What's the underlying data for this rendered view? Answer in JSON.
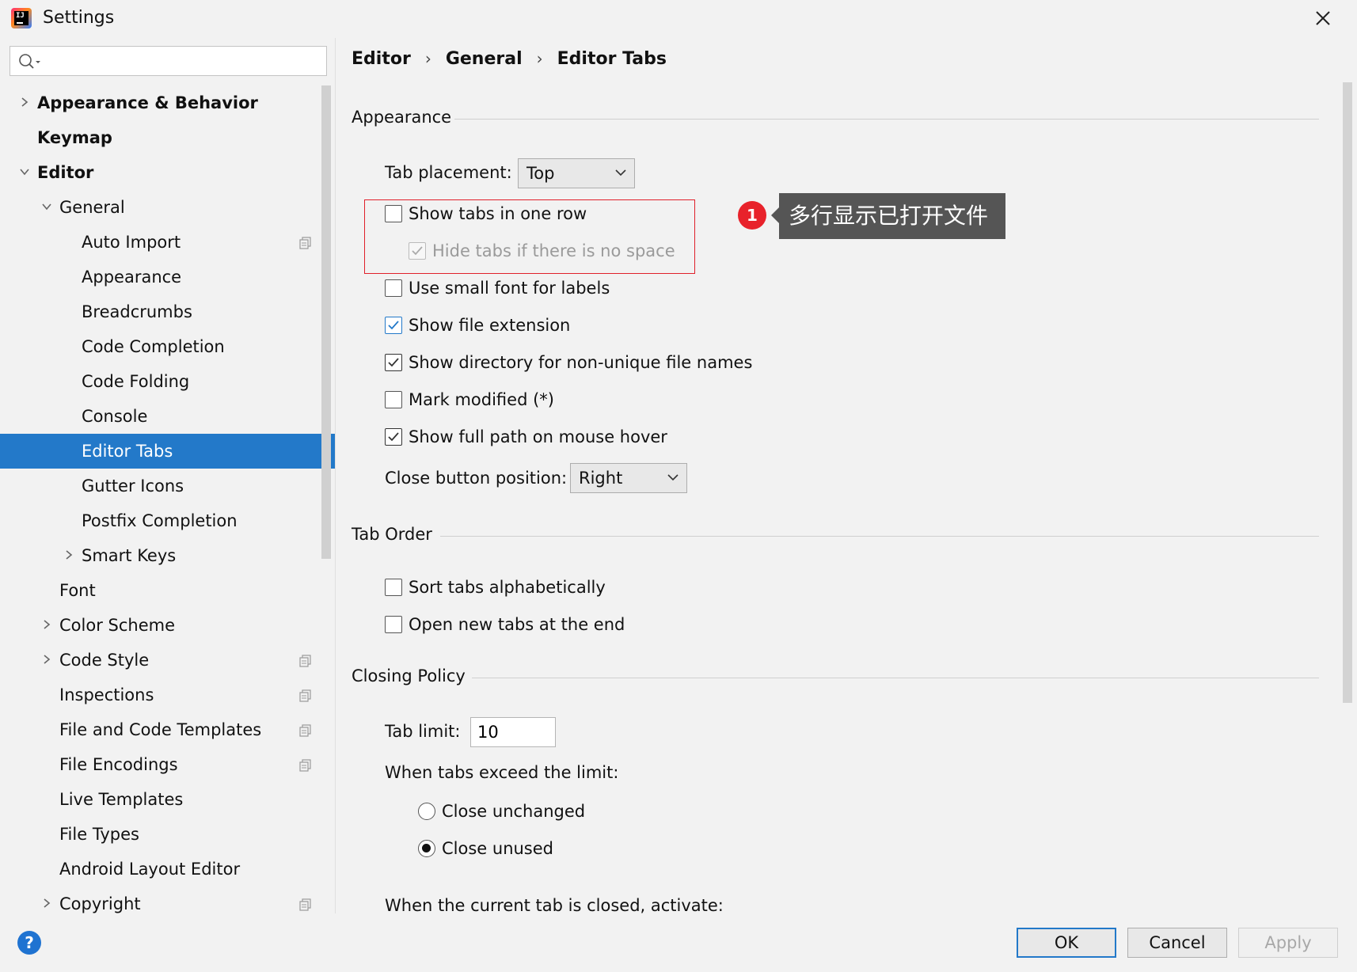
{
  "window": {
    "title": "Settings"
  },
  "search": {
    "placeholder": "",
    "value": ""
  },
  "tree": {
    "items": [
      {
        "label": "Appearance & Behavior",
        "chevron": "right",
        "bold": true,
        "level": 0
      },
      {
        "label": "Keymap",
        "chevron": "none",
        "bold": true,
        "level": 0
      },
      {
        "label": "Editor",
        "chevron": "down",
        "bold": true,
        "level": 0
      },
      {
        "label": "General",
        "chevron": "down",
        "bold": false,
        "level": 1
      },
      {
        "label": "Auto Import",
        "chevron": "none",
        "bold": false,
        "level": 2,
        "copy_icon": true
      },
      {
        "label": "Appearance",
        "chevron": "none",
        "bold": false,
        "level": 2
      },
      {
        "label": "Breadcrumbs",
        "chevron": "none",
        "bold": false,
        "level": 2
      },
      {
        "label": "Code Completion",
        "chevron": "none",
        "bold": false,
        "level": 2
      },
      {
        "label": "Code Folding",
        "chevron": "none",
        "bold": false,
        "level": 2
      },
      {
        "label": "Console",
        "chevron": "none",
        "bold": false,
        "level": 2
      },
      {
        "label": "Editor Tabs",
        "chevron": "none",
        "bold": false,
        "level": 2,
        "selected": true
      },
      {
        "label": "Gutter Icons",
        "chevron": "none",
        "bold": false,
        "level": 2
      },
      {
        "label": "Postfix Completion",
        "chevron": "none",
        "bold": false,
        "level": 2
      },
      {
        "label": "Smart Keys",
        "chevron": "right",
        "bold": false,
        "level": 2
      },
      {
        "label": "Font",
        "chevron": "none",
        "bold": false,
        "level": 1
      },
      {
        "label": "Color Scheme",
        "chevron": "right",
        "bold": false,
        "level": 1
      },
      {
        "label": "Code Style",
        "chevron": "right",
        "bold": false,
        "level": 1,
        "copy_icon": true
      },
      {
        "label": "Inspections",
        "chevron": "none",
        "bold": false,
        "level": 1,
        "copy_icon": true
      },
      {
        "label": "File and Code Templates",
        "chevron": "none",
        "bold": false,
        "level": 1,
        "copy_icon": true
      },
      {
        "label": "File Encodings",
        "chevron": "none",
        "bold": false,
        "level": 1,
        "copy_icon": true
      },
      {
        "label": "Live Templates",
        "chevron": "none",
        "bold": false,
        "level": 1
      },
      {
        "label": "File Types",
        "chevron": "none",
        "bold": false,
        "level": 1
      },
      {
        "label": "Android Layout Editor",
        "chevron": "none",
        "bold": false,
        "level": 1
      },
      {
        "label": "Copyright",
        "chevron": "right",
        "bold": false,
        "level": 1,
        "copy_icon": true
      }
    ]
  },
  "breadcrumb": {
    "items": [
      "Editor",
      "General",
      "Editor Tabs"
    ],
    "separator": "›"
  },
  "appearance": {
    "title": "Appearance",
    "tab_placement_label": "Tab placement:",
    "tab_placement_value": "Top",
    "show_tabs_one_row": {
      "label": "Show tabs in one row",
      "checked": false
    },
    "hide_tabs_no_space": {
      "label": "Hide tabs if there is no space",
      "checked": true,
      "disabled": true
    },
    "small_font": {
      "label": "Use small font for labels",
      "checked": false
    },
    "show_extension": {
      "label": "Show file extension",
      "checked": true
    },
    "show_directory": {
      "label": "Show directory for non-unique file names",
      "checked": true
    },
    "mark_modified": {
      "label": "Mark modified (*)",
      "checked": false
    },
    "full_path_hover": {
      "label": "Show full path on mouse hover",
      "checked": true
    },
    "close_button_label": "Close button position:",
    "close_button_value": "Right"
  },
  "annotation": {
    "badge": "1",
    "text": "多行显示已打开文件",
    "badge_color": "#e8222b",
    "box_color": "#e0202a"
  },
  "tab_order": {
    "title": "Tab Order",
    "sort_alpha": {
      "label": "Sort tabs alphabetically",
      "checked": false
    },
    "open_at_end": {
      "label": "Open new tabs at the end",
      "checked": false
    }
  },
  "closing_policy": {
    "title": "Closing Policy",
    "tab_limit_label": "Tab limit:",
    "tab_limit_value": "10",
    "exceed_label": "When tabs exceed the limit:",
    "close_unchanged": {
      "label": "Close unchanged",
      "selected": false
    },
    "close_unused": {
      "label": "Close unused",
      "selected": true
    },
    "when_closed_label": "When the current tab is closed, activate:"
  },
  "buttons": {
    "help": "?",
    "ok": "OK",
    "cancel": "Cancel",
    "apply": "Apply"
  },
  "colors": {
    "accent": "#2379c9",
    "background": "#f2f2f2"
  }
}
